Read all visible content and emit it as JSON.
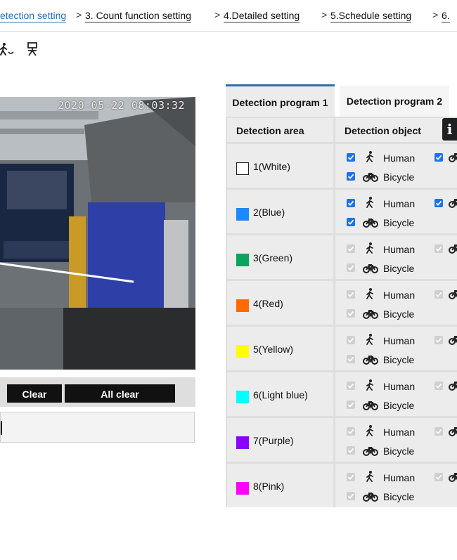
{
  "breadcrumb": {
    "items": [
      "etection setting",
      "3. Count function setting",
      "4.Detailed setting",
      "5.Schedule setting",
      "6."
    ],
    "separator": ">"
  },
  "toolbar": {
    "icons": [
      "person-walking-icon",
      "person-standing-icon"
    ]
  },
  "camera": {
    "timestamp": "2020-05-22 08:03:32"
  },
  "controls": {
    "clear_label": "Clear",
    "all_clear_label": "All clear"
  },
  "tabs": [
    {
      "label": "Detection program 1",
      "active": true
    },
    {
      "label": "Detection program 2",
      "active": false
    }
  ],
  "table": {
    "header_area": "Detection area",
    "header_object": "Detection object",
    "info_glyph": "i",
    "object_labels": {
      "human": "Human",
      "bicycle": "Bicycle"
    },
    "areas": [
      {
        "label": "1(White)",
        "color": "#ffffff",
        "enabled": true
      },
      {
        "label": "2(Blue)",
        "color": "#1e88ff",
        "enabled": true
      },
      {
        "label": "3(Green)",
        "color": "#0aa45f",
        "enabled": false
      },
      {
        "label": "4(Red)",
        "color": "#ff6a00",
        "enabled": false
      },
      {
        "label": "5(Yellow)",
        "color": "#ffff00",
        "enabled": false
      },
      {
        "label": "6(Light blue)",
        "color": "#00ffff",
        "enabled": false
      },
      {
        "label": "7(Purple)",
        "color": "#8a00ff",
        "enabled": false
      },
      {
        "label": "8(Pink)",
        "color": "#ff00ff",
        "enabled": false
      }
    ]
  }
}
